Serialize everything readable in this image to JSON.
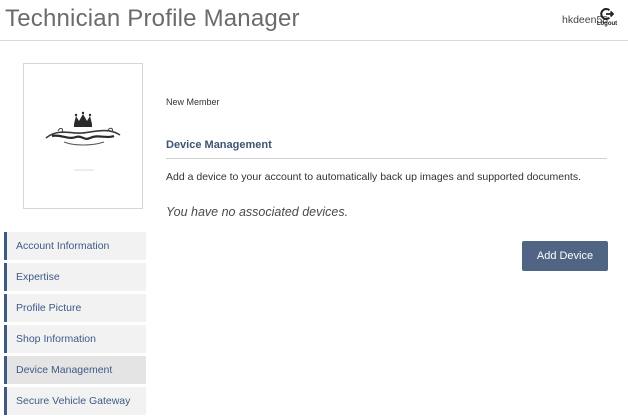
{
  "header": {
    "title": "Technician Profile Manager",
    "username": "hkdeen58",
    "logout_label": "Logout",
    "logout_icon": "logout-icon"
  },
  "profile": {
    "member_status": "New Member",
    "avatar_icon": "crown-logo"
  },
  "sidebar": {
    "items": [
      {
        "label": "Account Information"
      },
      {
        "label": "Expertise"
      },
      {
        "label": "Profile Picture"
      },
      {
        "label": "Shop Information"
      },
      {
        "label": "Device Management",
        "active": true
      },
      {
        "label": "Secure Vehicle Gateway"
      }
    ]
  },
  "main": {
    "section_title": "Device Management",
    "description": "Add a device to your account to automatically back up images and supported documents.",
    "empty_message": "You have no associated devices.",
    "add_button_label": "Add Device"
  },
  "colors": {
    "accent": "#3f5a85",
    "button": "#4f6583",
    "nav_bg": "#f2f2f2",
    "nav_active_bg": "#e4e4e4"
  }
}
